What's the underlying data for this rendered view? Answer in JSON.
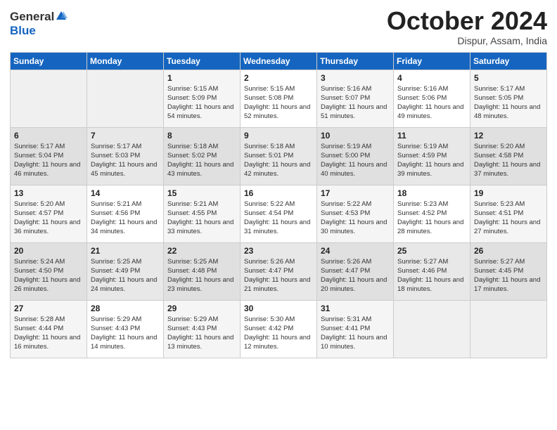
{
  "header": {
    "logo_general": "General",
    "logo_blue": "Blue",
    "month": "October 2024",
    "location": "Dispur, Assam, India"
  },
  "days_of_week": [
    "Sunday",
    "Monday",
    "Tuesday",
    "Wednesday",
    "Thursday",
    "Friday",
    "Saturday"
  ],
  "weeks": [
    [
      {
        "day": "",
        "info": ""
      },
      {
        "day": "",
        "info": ""
      },
      {
        "day": "1",
        "sunrise": "Sunrise: 5:15 AM",
        "sunset": "Sunset: 5:09 PM",
        "daylight": "Daylight: 11 hours and 54 minutes."
      },
      {
        "day": "2",
        "sunrise": "Sunrise: 5:15 AM",
        "sunset": "Sunset: 5:08 PM",
        "daylight": "Daylight: 11 hours and 52 minutes."
      },
      {
        "day": "3",
        "sunrise": "Sunrise: 5:16 AM",
        "sunset": "Sunset: 5:07 PM",
        "daylight": "Daylight: 11 hours and 51 minutes."
      },
      {
        "day": "4",
        "sunrise": "Sunrise: 5:16 AM",
        "sunset": "Sunset: 5:06 PM",
        "daylight": "Daylight: 11 hours and 49 minutes."
      },
      {
        "day": "5",
        "sunrise": "Sunrise: 5:17 AM",
        "sunset": "Sunset: 5:05 PM",
        "daylight": "Daylight: 11 hours and 48 minutes."
      }
    ],
    [
      {
        "day": "6",
        "sunrise": "Sunrise: 5:17 AM",
        "sunset": "Sunset: 5:04 PM",
        "daylight": "Daylight: 11 hours and 46 minutes."
      },
      {
        "day": "7",
        "sunrise": "Sunrise: 5:17 AM",
        "sunset": "Sunset: 5:03 PM",
        "daylight": "Daylight: 11 hours and 45 minutes."
      },
      {
        "day": "8",
        "sunrise": "Sunrise: 5:18 AM",
        "sunset": "Sunset: 5:02 PM",
        "daylight": "Daylight: 11 hours and 43 minutes."
      },
      {
        "day": "9",
        "sunrise": "Sunrise: 5:18 AM",
        "sunset": "Sunset: 5:01 PM",
        "daylight": "Daylight: 11 hours and 42 minutes."
      },
      {
        "day": "10",
        "sunrise": "Sunrise: 5:19 AM",
        "sunset": "Sunset: 5:00 PM",
        "daylight": "Daylight: 11 hours and 40 minutes."
      },
      {
        "day": "11",
        "sunrise": "Sunrise: 5:19 AM",
        "sunset": "Sunset: 4:59 PM",
        "daylight": "Daylight: 11 hours and 39 minutes."
      },
      {
        "day": "12",
        "sunrise": "Sunrise: 5:20 AM",
        "sunset": "Sunset: 4:58 PM",
        "daylight": "Daylight: 11 hours and 37 minutes."
      }
    ],
    [
      {
        "day": "13",
        "sunrise": "Sunrise: 5:20 AM",
        "sunset": "Sunset: 4:57 PM",
        "daylight": "Daylight: 11 hours and 36 minutes."
      },
      {
        "day": "14",
        "sunrise": "Sunrise: 5:21 AM",
        "sunset": "Sunset: 4:56 PM",
        "daylight": "Daylight: 11 hours and 34 minutes."
      },
      {
        "day": "15",
        "sunrise": "Sunrise: 5:21 AM",
        "sunset": "Sunset: 4:55 PM",
        "daylight": "Daylight: 11 hours and 33 minutes."
      },
      {
        "day": "16",
        "sunrise": "Sunrise: 5:22 AM",
        "sunset": "Sunset: 4:54 PM",
        "daylight": "Daylight: 11 hours and 31 minutes."
      },
      {
        "day": "17",
        "sunrise": "Sunrise: 5:22 AM",
        "sunset": "Sunset: 4:53 PM",
        "daylight": "Daylight: 11 hours and 30 minutes."
      },
      {
        "day": "18",
        "sunrise": "Sunrise: 5:23 AM",
        "sunset": "Sunset: 4:52 PM",
        "daylight": "Daylight: 11 hours and 28 minutes."
      },
      {
        "day": "19",
        "sunrise": "Sunrise: 5:23 AM",
        "sunset": "Sunset: 4:51 PM",
        "daylight": "Daylight: 11 hours and 27 minutes."
      }
    ],
    [
      {
        "day": "20",
        "sunrise": "Sunrise: 5:24 AM",
        "sunset": "Sunset: 4:50 PM",
        "daylight": "Daylight: 11 hours and 26 minutes."
      },
      {
        "day": "21",
        "sunrise": "Sunrise: 5:25 AM",
        "sunset": "Sunset: 4:49 PM",
        "daylight": "Daylight: 11 hours and 24 minutes."
      },
      {
        "day": "22",
        "sunrise": "Sunrise: 5:25 AM",
        "sunset": "Sunset: 4:48 PM",
        "daylight": "Daylight: 11 hours and 23 minutes."
      },
      {
        "day": "23",
        "sunrise": "Sunrise: 5:26 AM",
        "sunset": "Sunset: 4:47 PM",
        "daylight": "Daylight: 11 hours and 21 minutes."
      },
      {
        "day": "24",
        "sunrise": "Sunrise: 5:26 AM",
        "sunset": "Sunset: 4:47 PM",
        "daylight": "Daylight: 11 hours and 20 minutes."
      },
      {
        "day": "25",
        "sunrise": "Sunrise: 5:27 AM",
        "sunset": "Sunset: 4:46 PM",
        "daylight": "Daylight: 11 hours and 18 minutes."
      },
      {
        "day": "26",
        "sunrise": "Sunrise: 5:27 AM",
        "sunset": "Sunset: 4:45 PM",
        "daylight": "Daylight: 11 hours and 17 minutes."
      }
    ],
    [
      {
        "day": "27",
        "sunrise": "Sunrise: 5:28 AM",
        "sunset": "Sunset: 4:44 PM",
        "daylight": "Daylight: 11 hours and 16 minutes."
      },
      {
        "day": "28",
        "sunrise": "Sunrise: 5:29 AM",
        "sunset": "Sunset: 4:43 PM",
        "daylight": "Daylight: 11 hours and 14 minutes."
      },
      {
        "day": "29",
        "sunrise": "Sunrise: 5:29 AM",
        "sunset": "Sunset: 4:43 PM",
        "daylight": "Daylight: 11 hours and 13 minutes."
      },
      {
        "day": "30",
        "sunrise": "Sunrise: 5:30 AM",
        "sunset": "Sunset: 4:42 PM",
        "daylight": "Daylight: 11 hours and 12 minutes."
      },
      {
        "day": "31",
        "sunrise": "Sunrise: 5:31 AM",
        "sunset": "Sunset: 4:41 PM",
        "daylight": "Daylight: 11 hours and 10 minutes."
      },
      {
        "day": "",
        "info": ""
      },
      {
        "day": "",
        "info": ""
      }
    ]
  ]
}
